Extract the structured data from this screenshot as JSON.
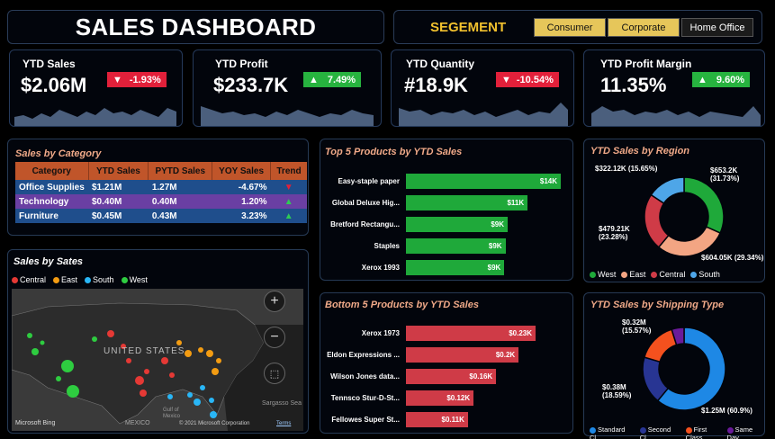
{
  "header": {
    "title": "SALES DASHBOARD"
  },
  "segment": {
    "label": "SEGEMENT",
    "buttons": [
      "Consumer",
      "Corporate",
      "Home Office"
    ]
  },
  "kpis": [
    {
      "title": "YTD Sales",
      "value": "$2.06M",
      "change": "-1.93%",
      "direction": "down"
    },
    {
      "title": "YTD Profit",
      "value": "$233.7K",
      "change": "7.49%",
      "direction": "up"
    },
    {
      "title": "YTD Quantity",
      "value": "#18.9K",
      "change": "-10.54%",
      "direction": "down"
    },
    {
      "title": "YTD Profit Margin",
      "value": "11.35%",
      "change": "9.60%",
      "direction": "up"
    }
  ],
  "category": {
    "title": "Sales by Category",
    "columns": [
      "Category",
      "YTD Sales",
      "PYTD Sales",
      "YOY Sales",
      "Trend"
    ],
    "rows": [
      {
        "category": "Office Supplies",
        "ytd": "$1.21M",
        "pytd": "1.27M",
        "yoy": "-4.67%",
        "trend": "down"
      },
      {
        "category": "Technology",
        "ytd": "$0.40M",
        "pytd": "0.40M",
        "yoy": "1.20%",
        "trend": "up"
      },
      {
        "category": "Furniture",
        "ytd": "$0.45M",
        "pytd": "0.43M",
        "yoy": "3.23%",
        "trend": "up"
      }
    ]
  },
  "map": {
    "title": "Sales by Sates",
    "legend": [
      "Central",
      "East",
      "South",
      "West"
    ],
    "country_label": "UNITED STATES",
    "mexico_label": "MEXICO",
    "sea_label": "Sargasso Sea",
    "gulf_label": "Gulf of Mexico",
    "bing_label": "Microsoft Bing",
    "copyright": "© 2021 Microsoft Corporation",
    "terms": "Terms"
  },
  "top5": {
    "title": "Top 5 Products by YTD Sales",
    "items": [
      {
        "name": "Easy-staple paper",
        "value": "$14K",
        "amount": 14
      },
      {
        "name": "Global Deluxe Hig...",
        "value": "$11K",
        "amount": 11
      },
      {
        "name": "Bretford Rectangu...",
        "value": "$9K",
        "amount": 9.2
      },
      {
        "name": "Staples",
        "value": "$9K",
        "amount": 9.0
      },
      {
        "name": "Xerox 1993",
        "value": "$9K",
        "amount": 8.9
      }
    ]
  },
  "bottom5": {
    "title": "Bottom 5 Products by YTD Sales",
    "items": [
      {
        "name": "Xerox 1973",
        "value": "$0.23K",
        "amount": 0.23
      },
      {
        "name": "Eldon Expressions ...",
        "value": "$0.2K",
        "amount": 0.2
      },
      {
        "name": "Wilson Jones data...",
        "value": "$0.16K",
        "amount": 0.16
      },
      {
        "name": "Tennsco Stur-D-St...",
        "value": "$0.12K",
        "amount": 0.12
      },
      {
        "name": "Fellowes Super St...",
        "value": "$0.11K",
        "amount": 0.11
      }
    ]
  },
  "region": {
    "title": "YTD Sales by Region",
    "legend": [
      "West",
      "East",
      "Central",
      "South"
    ],
    "labels": {
      "west": "$653.2K\n(31.73%)",
      "east": "$604.05K (29.34%)",
      "central": "$479.21K\n(23.28%)",
      "south": "$322.12K (15.65%)"
    }
  },
  "shipping": {
    "title": "YTD Sales by Shipping Type",
    "legend": [
      "Standard Cl...",
      "Second Cl...",
      "First Class",
      "Same Day"
    ],
    "labels": {
      "standard": "$1.25M (60.9%)",
      "second": "$0.38M\n(18.59%)",
      "first": "$0.32M\n(15.57%)"
    }
  },
  "colors": {
    "green": "#1fa93a",
    "red": "#cf3b47",
    "blue": "#1e88e5",
    "orange": "#f3a583",
    "segment_active": "#e6c65a",
    "title_accent": "#f0a988"
  },
  "chart_data": [
    {
      "type": "pie",
      "title": "YTD Sales by Region",
      "categories": [
        "West",
        "East",
        "Central",
        "South"
      ],
      "values": [
        653.2,
        604.05,
        479.21,
        322.12
      ],
      "percent": [
        31.73,
        29.34,
        23.28,
        15.65
      ]
    },
    {
      "type": "pie",
      "title": "YTD Sales by Shipping Type",
      "categories": [
        "Standard Cl...",
        "Second Cl...",
        "First Class",
        "Same Day"
      ],
      "values": [
        1.25,
        0.38,
        0.32,
        0.1
      ],
      "percent": [
        60.9,
        18.59,
        15.57,
        4.94
      ]
    }
  ]
}
